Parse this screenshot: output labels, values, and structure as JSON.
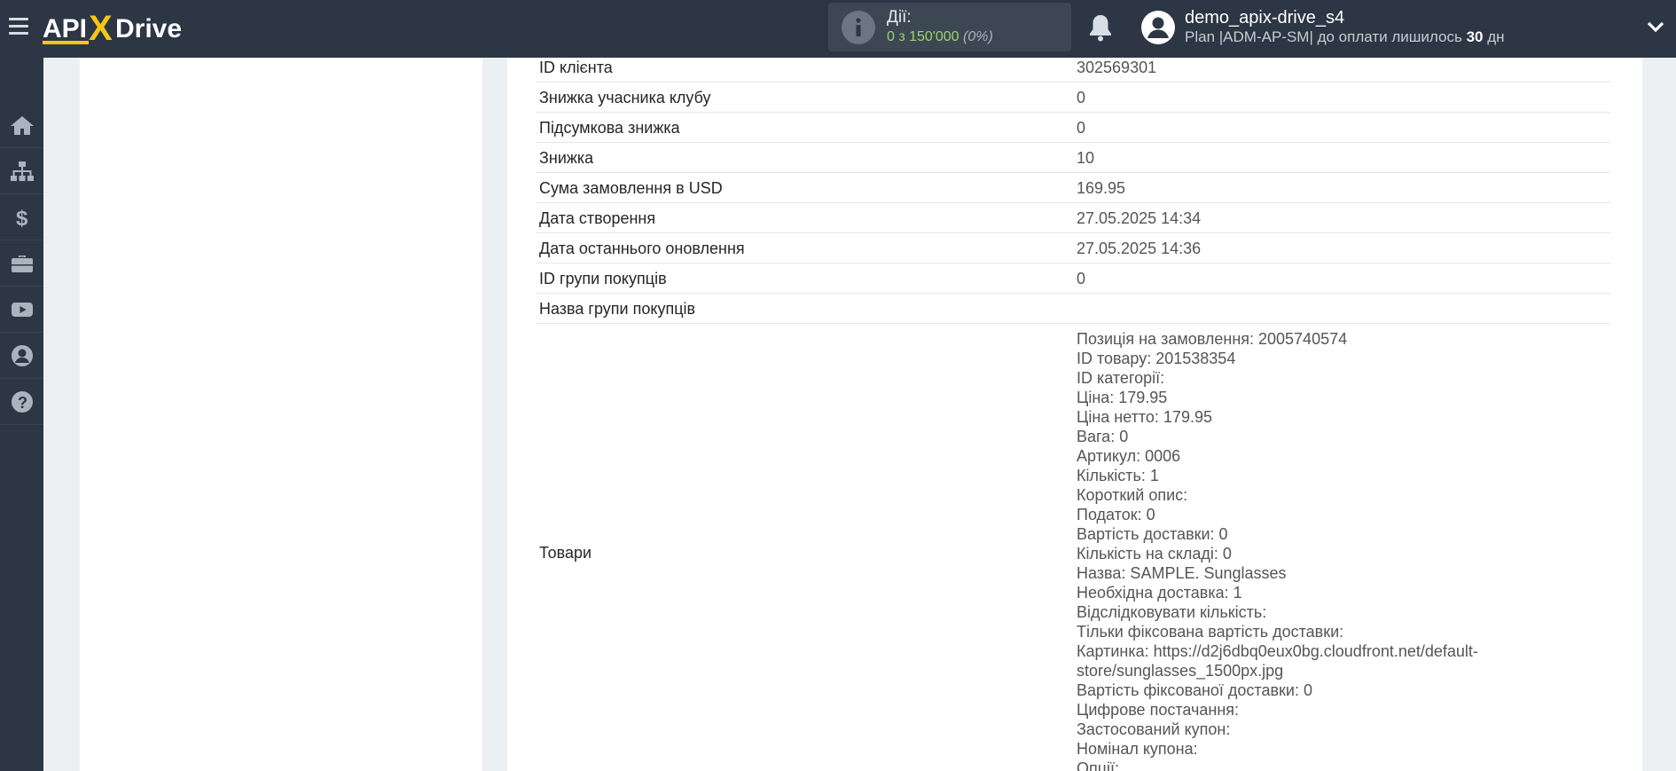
{
  "header": {
    "logo_text": "APIXDrive",
    "actions": {
      "label": "Дії:",
      "count": "0 з 150'000",
      "percent": "(0%)"
    },
    "user": {
      "name": "demo_apix-drive_s4",
      "plan_prefix": "Plan |ADM-AP-SM| до оплати лишилось",
      "plan_days": "30",
      "plan_suffix": "дн"
    }
  },
  "sidebar": {
    "items": [
      {
        "icon": "home-icon"
      },
      {
        "icon": "sitemap-icon"
      },
      {
        "icon": "dollar-icon"
      },
      {
        "icon": "briefcase-icon"
      },
      {
        "icon": "youtube-icon"
      },
      {
        "icon": "user-icon"
      },
      {
        "icon": "help-icon"
      }
    ]
  },
  "rows": [
    {
      "label": "ID клієнта",
      "value": "302569301"
    },
    {
      "label": "Знижка учасника клубу",
      "value": "0"
    },
    {
      "label": "Підсумкова знижка",
      "value": "0"
    },
    {
      "label": "Знижка",
      "value": "10"
    },
    {
      "label": "Сума замовлення в USD",
      "value": "169.95"
    },
    {
      "label": "Дата створення",
      "value": "27.05.2025 14:34"
    },
    {
      "label": "Дата останнього оновлення",
      "value": "27.05.2025 14:36"
    },
    {
      "label": "ID групи покупців",
      "value": "0"
    },
    {
      "label": "Назва групи покупців",
      "value": ""
    }
  ],
  "goods": {
    "label": "Товари",
    "lines": [
      "Позиція на замовлення: 2005740574",
      "ID товару: 201538354",
      "ID категорії:",
      "Ціна: 179.95",
      "Ціна нетто: 179.95",
      "Вага: 0",
      "Артикул: 0006",
      "Кількість: 1",
      "Короткий опис:",
      "Податок: 0",
      "Вартість доставки: 0",
      "Кількість на складі: 0",
      "Назва: SAMPLE. Sunglasses",
      "Необхідна доставка: 1",
      "Відслідковувати кількість:",
      "Тільки фіксована вартість доставки:",
      "Картинка: https://d2j6dbq0eux0bg.cloudfront.net/default-",
      "store/sunglasses_1500px.jpg",
      "Вартість фіксованої доставки: 0",
      "Цифрове постачання:",
      "Застосований купон:",
      "Номінал купона:",
      "Опції:"
    ]
  }
}
